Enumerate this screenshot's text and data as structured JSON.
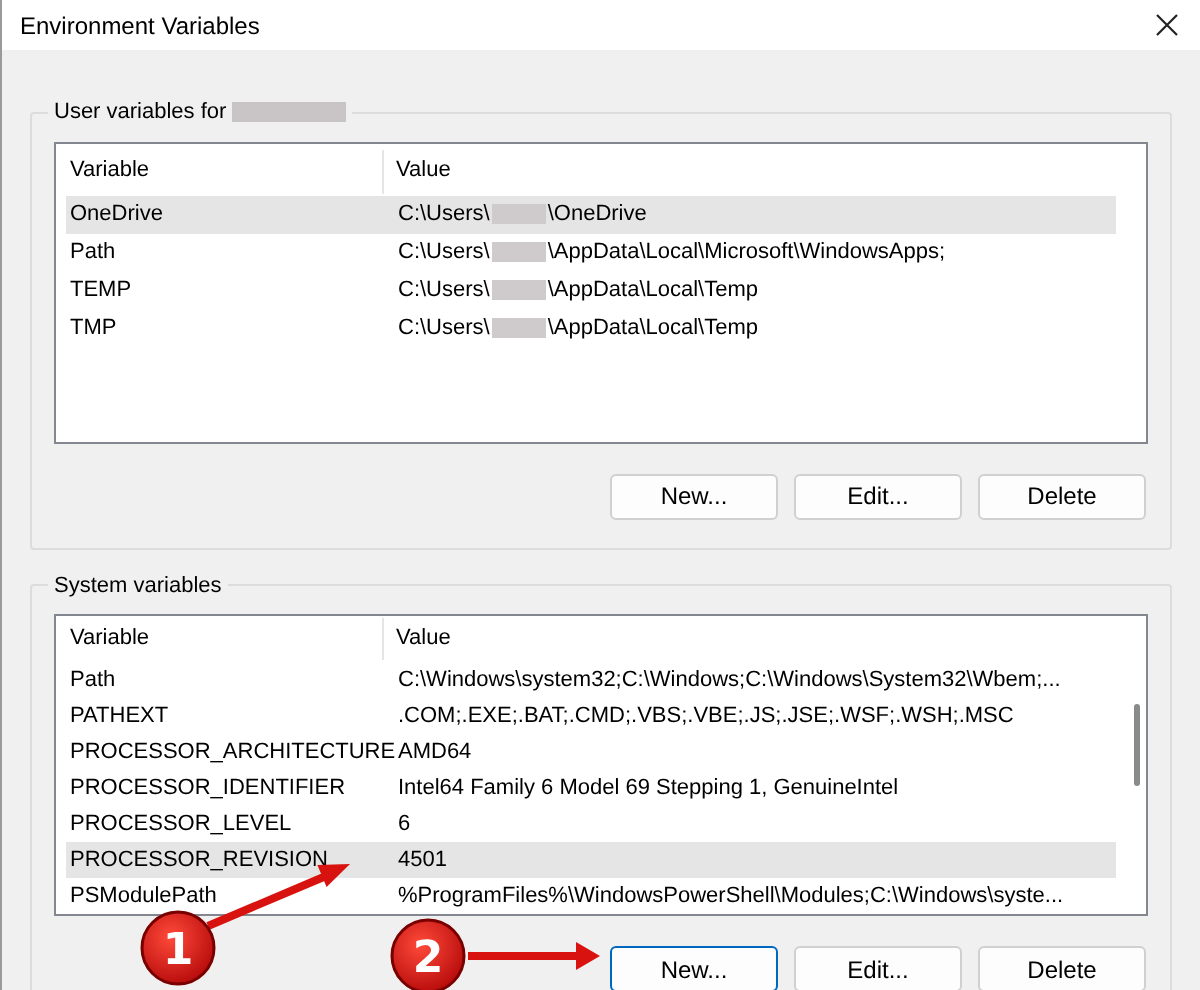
{
  "window": {
    "title": "Environment Variables"
  },
  "user_variables": {
    "label": "User variables for",
    "username_redacted": true,
    "columns": [
      "Variable",
      "Value"
    ],
    "rows": [
      {
        "variable": "OneDrive",
        "value_start": "C:\\Users\\",
        "value_end": "\\OneDrive",
        "selected": true
      },
      {
        "variable": "Path",
        "value_start": "C:\\Users\\",
        "value_end": "\\AppData\\Local\\Microsoft\\WindowsApps;",
        "selected": false
      },
      {
        "variable": "TEMP",
        "value_start": "C:\\Users\\",
        "value_end": "\\AppData\\Local\\Temp",
        "selected": false
      },
      {
        "variable": "TMP",
        "value_start": "C:\\Users\\",
        "value_end": "\\AppData\\Local\\Temp",
        "selected": false
      }
    ],
    "buttons": [
      {
        "label": "New...",
        "focused": false
      },
      {
        "label": "Edit...",
        "focused": false
      },
      {
        "label": "Delete",
        "focused": false
      }
    ]
  },
  "system_variables": {
    "label": "System variables",
    "columns": [
      "Variable",
      "Value"
    ],
    "rows": [
      {
        "variable": "Path",
        "value": "C:\\Windows\\system32;C:\\Windows;C:\\Windows\\System32\\Wbem;...",
        "selected": false
      },
      {
        "variable": "PATHEXT",
        "value": ".COM;.EXE;.BAT;.CMD;.VBS;.VBE;.JS;.JSE;.WSF;.WSH;.MSC",
        "selected": false
      },
      {
        "variable": "PROCESSOR_ARCHITECTURE",
        "value": "AMD64",
        "selected": false
      },
      {
        "variable": "PROCESSOR_IDENTIFIER",
        "value": "Intel64 Family 6 Model 69 Stepping 1, GenuineIntel",
        "selected": false
      },
      {
        "variable": "PROCESSOR_LEVEL",
        "value": "6",
        "selected": false
      },
      {
        "variable": "PROCESSOR_REVISION",
        "value": "4501",
        "selected": true
      },
      {
        "variable": "PSModulePath",
        "value": "%ProgramFiles%\\WindowsPowerShell\\Modules;C:\\Windows\\syste...",
        "selected": false
      }
    ],
    "buttons": [
      {
        "label": "New...",
        "focused": true
      },
      {
        "label": "Edit...",
        "focused": false
      },
      {
        "label": "Delete",
        "focused": false
      }
    ]
  },
  "annotations": [
    {
      "number": "1"
    },
    {
      "number": "2"
    }
  ]
}
